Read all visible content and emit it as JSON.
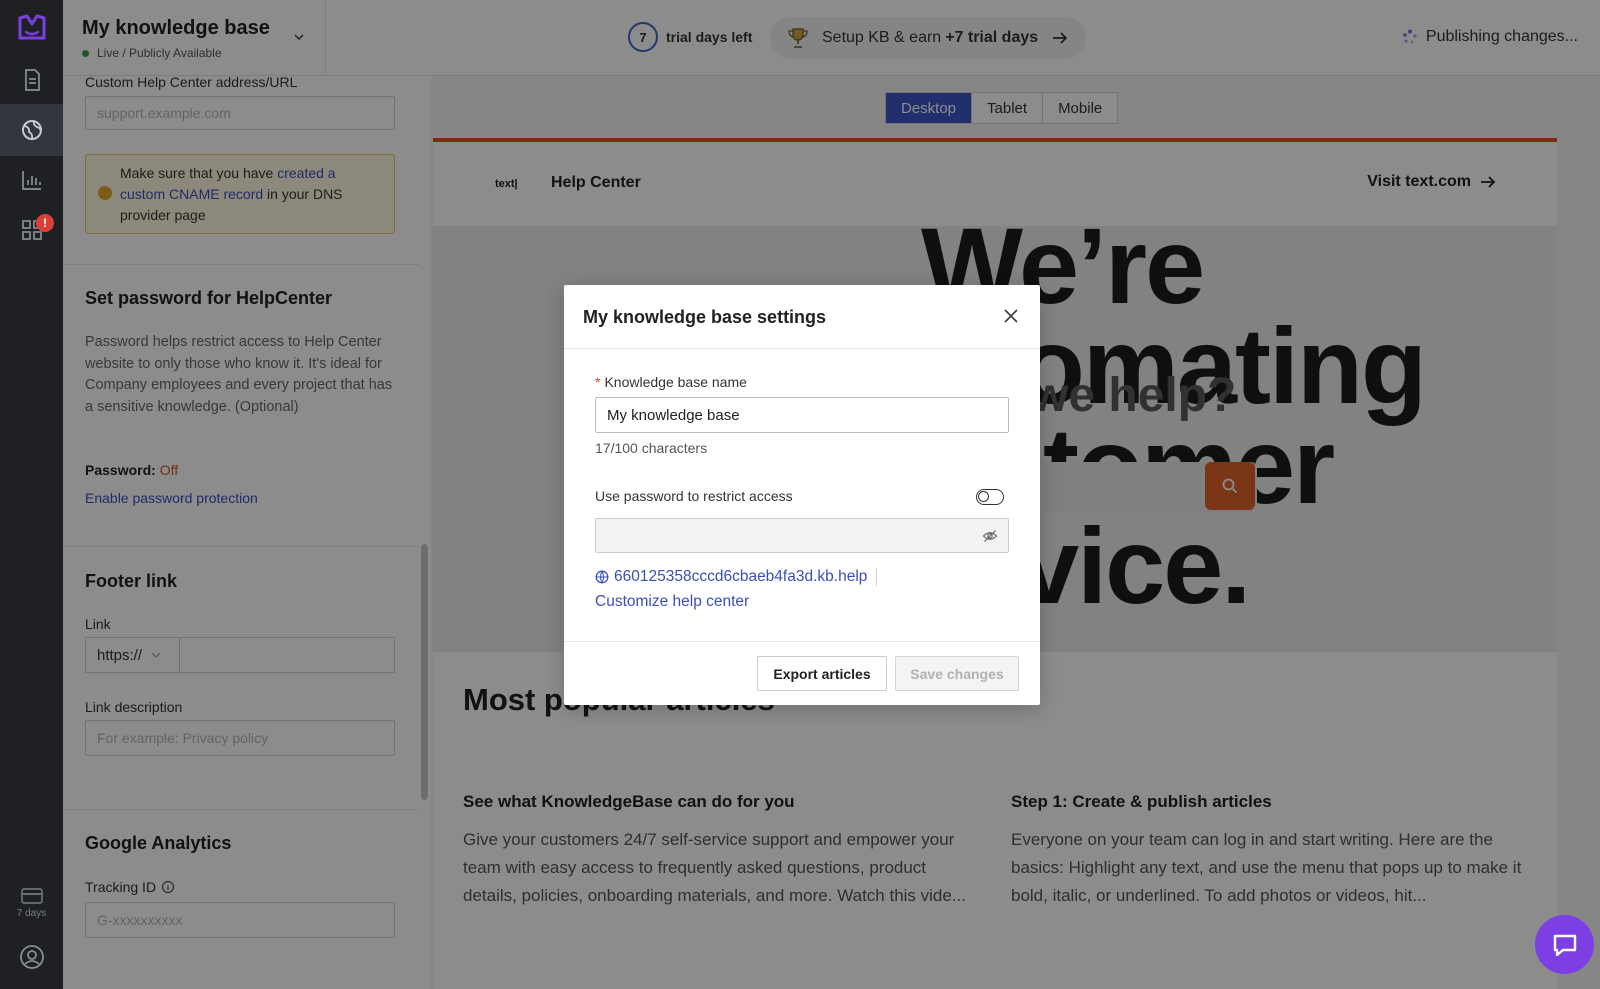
{
  "rail": {
    "brand_color": "#7b3fe4",
    "items": [
      "articles-icon",
      "globe-icon",
      "reports-icon",
      "apps-icon"
    ],
    "apps_badge": "!",
    "trial_label": "7 days"
  },
  "topbar": {
    "kb_title": "My knowledge base",
    "kb_status": "Live / Publicly Available",
    "trial_days": "7",
    "trial_text": "trial days left",
    "setup_text": "Setup KB & earn",
    "setup_bonus": "+7 trial days",
    "publishing": "Publishing changes..."
  },
  "panel": {
    "custom_url_label": "Custom Help Center address/URL",
    "custom_url_placeholder": "support.example.com",
    "warn_prefix": "Make sure that you have",
    "warn_link": "created a custom CNAME record",
    "warn_suffix": "in your DNS provider page",
    "password_title": "Set password for HelpCenter",
    "password_desc": "Password helps restrict access to Help Center website to only those who know it. It's ideal for Company employees and every project that has a sensitive knowledge. (Optional)",
    "password_label": "Password:",
    "password_value": "Off",
    "password_link": "Enable password protection",
    "footer_title": "Footer link",
    "link_label": "Link",
    "link_protocol": "https://",
    "link_desc_label": "Link description",
    "link_desc_placeholder": "For example: Privacy policy",
    "ga_title": "Google Analytics",
    "tracking_label": "Tracking ID",
    "tracking_placeholder": "G-xxxxxxxxxx"
  },
  "preview": {
    "tabs": [
      "Desktop",
      "Tablet",
      "Mobile"
    ],
    "active_tab": "Desktop",
    "site_logo": "text|",
    "site_name": "Help Center",
    "visit_link": "Visit text.com",
    "hero_text": "We’re\nutomating\nustomer\nervice.",
    "hero_question": "we help?",
    "section_title": "Most popular articles",
    "cards": [
      {
        "title": "See what KnowledgeBase can do for you",
        "text": "Give your customers 24/7 self-service support and empower your team with easy access to frequently asked questions, product details, policies, onboarding materials, and more. Watch this vide..."
      },
      {
        "title": "Step 1: Create & publish articles",
        "text": "Everyone on your team can log in and start writing. Here are the basics: Highlight any text, and use the menu that pops up to make it bold, italic, or underlined. To add photos or videos, hit..."
      }
    ],
    "accent_color": "#e0632a"
  },
  "modal": {
    "title": "My knowledge base settings",
    "name_label": "Knowledge base name",
    "name_value": "My knowledge base",
    "char_count": "17/100 characters",
    "password_toggle_label": "Use password to restrict access",
    "password_toggle_on": false,
    "kb_url": "660125358cccd6cbaeb4fa3d.kb.help",
    "customize_link": "Customize help center",
    "export_button": "Export articles",
    "save_button": "Save changes"
  }
}
